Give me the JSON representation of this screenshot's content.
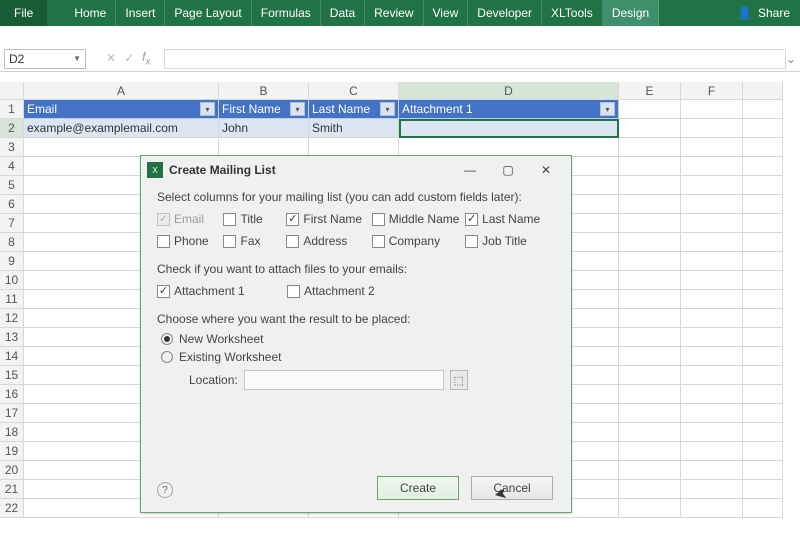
{
  "ribbon": {
    "tabs": [
      "File",
      "Home",
      "Insert",
      "Page Layout",
      "Formulas",
      "Data",
      "Review",
      "View",
      "Developer",
      "XLTools",
      "Design"
    ],
    "activeTab": "Design",
    "share": "Share"
  },
  "formulaBar": {
    "nameBox": "D2",
    "formula": ""
  },
  "columns": [
    "A",
    "B",
    "C",
    "D",
    "E",
    "F"
  ],
  "rows": [
    "1",
    "2",
    "3",
    "4",
    "5",
    "6",
    "7",
    "8",
    "9",
    "10",
    "11",
    "12",
    "13",
    "14",
    "15",
    "16",
    "17",
    "18",
    "19",
    "20",
    "21",
    "22"
  ],
  "table": {
    "headers": [
      "Email",
      "First Name",
      "Last Name",
      "Attachment 1"
    ],
    "row2": [
      "example@examplemail.com",
      "John",
      "Smith",
      ""
    ]
  },
  "dialog": {
    "title": "Create Mailing List",
    "sec1": "Select columns for your mailing list (you can add custom fields later):",
    "fields": {
      "email": "Email",
      "title": "Title",
      "firstName": "First Name",
      "middleName": "Middle Name",
      "lastName": "Last Name",
      "phone": "Phone",
      "fax": "Fax",
      "address": "Address",
      "company": "Company",
      "jobTitle": "Job Title"
    },
    "sec2": "Check if you want to attach files to your emails:",
    "attach": {
      "a1": "Attachment 1",
      "a2": "Attachment 2"
    },
    "sec3": "Choose where you want the result to be placed:",
    "radios": {
      "newWs": "New Worksheet",
      "exWs": "Existing Worksheet"
    },
    "location": "Location:",
    "buttons": {
      "create": "Create",
      "cancel": "Cancel"
    }
  }
}
